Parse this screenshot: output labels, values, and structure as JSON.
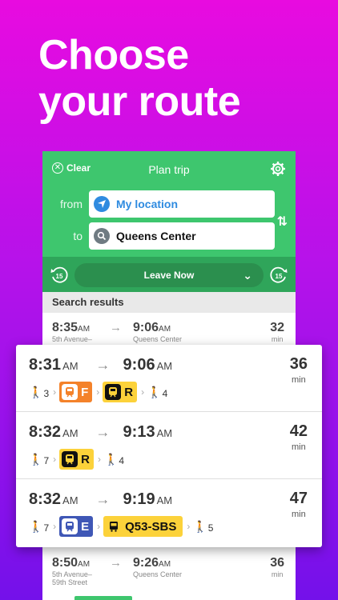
{
  "headline": {
    "line1": "Choose",
    "line2": "your route"
  },
  "header": {
    "clear_label": "Clear",
    "title": "Plan trip"
  },
  "trip": {
    "from_label": "from",
    "from_value": "My location",
    "to_label": "to",
    "to_value": "Queens Center",
    "leave_label": "Leave Now",
    "skip_back": "15",
    "skip_fwd": "15"
  },
  "results": {
    "heading": "Search results",
    "bg_row1": {
      "dep": "8:35",
      "dep_ampm": "AM",
      "dep_sub": "5th Avenue–",
      "arr": "9:06",
      "arr_ampm": "AM",
      "arr_sub": "Queens Center",
      "dur": "32",
      "unit": "min"
    },
    "bg_row2": {
      "dep": "8:50",
      "dep_ampm": "AM",
      "dep_sub": "5th Avenue–",
      "dep_sub2": "59th Street",
      "arr": "9:26",
      "arr_ampm": "AM",
      "arr_sub": "Queens Center",
      "dur": "36",
      "unit": "min"
    }
  },
  "routes": [
    {
      "dep": "8:31",
      "dep_ampm": "AM",
      "arr": "9:06",
      "arr_ampm": "AM",
      "dur": "36",
      "unit": "min",
      "walk1": "3",
      "line1": "F",
      "line2": "R",
      "walk2": "4"
    },
    {
      "dep": "8:32",
      "dep_ampm": "AM",
      "arr": "9:13",
      "arr_ampm": "AM",
      "dur": "42",
      "unit": "min",
      "walk1": "7",
      "line1": "R",
      "walk2": "4"
    },
    {
      "dep": "8:32",
      "dep_ampm": "AM",
      "arr": "9:19",
      "arr_ampm": "AM",
      "dur": "47",
      "unit": "min",
      "walk1": "7",
      "line1": "E",
      "line2": "Q53-SBS",
      "walk2": "5"
    }
  ],
  "colors": {
    "green": "#3ec66e",
    "dark_green": "#2fa55a",
    "subway_yellow": "#fcd23a",
    "subway_orange": "#f4822a",
    "subway_blue": "#3f57b6"
  },
  "icons": [
    "close-icon",
    "gear-icon",
    "location-arrow-icon",
    "search-icon",
    "swap-icon",
    "skip-back-icon",
    "skip-forward-icon",
    "chevron-down-icon",
    "walk-icon",
    "subway-icon",
    "bus-icon",
    "arrow-right-icon"
  ]
}
